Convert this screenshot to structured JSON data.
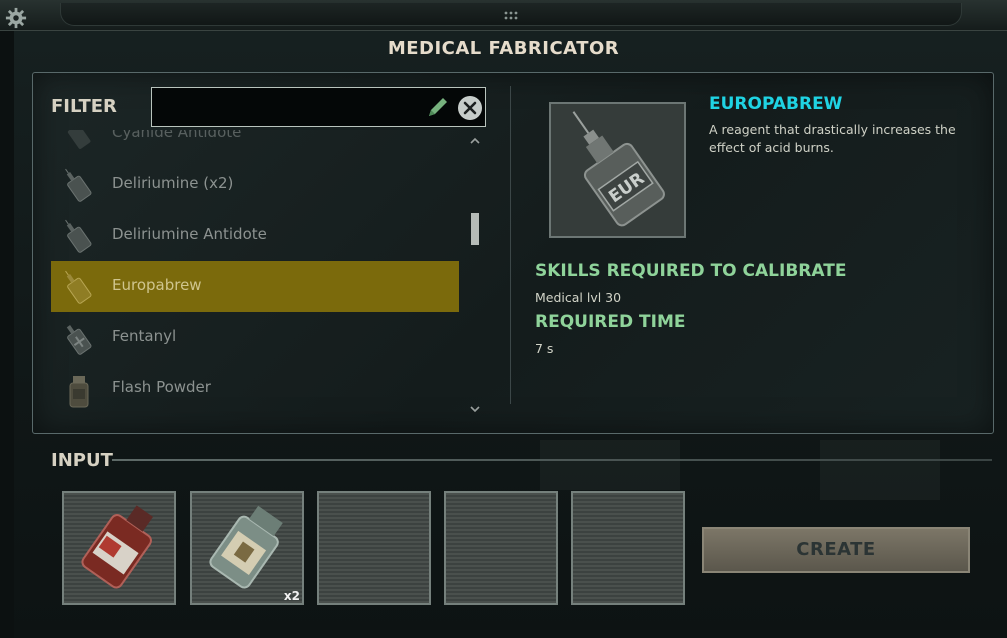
{
  "window": {
    "title": "MEDICAL FABRICATOR"
  },
  "filter": {
    "label": "FILTER",
    "value": ""
  },
  "list": {
    "items": [
      {
        "label": "Cyanide Antidote",
        "icon": "syringe-icon",
        "state": "partial"
      },
      {
        "label": "Deliriumine (x2)",
        "icon": "syringe-del-icon",
        "state": "normal"
      },
      {
        "label": "Deliriumine Antidote",
        "icon": "syringe-antidote-icon",
        "state": "normal"
      },
      {
        "label": "Europabrew",
        "icon": "syringe-eur-icon",
        "state": "selected"
      },
      {
        "label": "Fentanyl",
        "icon": "syringe-plus-icon",
        "state": "normal"
      },
      {
        "label": "Flash Powder",
        "icon": "bottle-icon",
        "state": "normal"
      }
    ]
  },
  "details": {
    "name": "EUROPABREW",
    "description": "A reagent that drastically increases the effect of acid burns.",
    "vial_label": "EUR",
    "skills_heading": "SKILLS REQUIRED TO CALIBRATE",
    "skills_value": "Medical lvl 30",
    "time_heading": "REQUIRED TIME",
    "time_value": "7 s"
  },
  "input": {
    "label": "INPUT",
    "slots": [
      {
        "icon": "blood-bottle-icon",
        "count": ""
      },
      {
        "icon": "pill-bottle-icon",
        "count": "x2"
      },
      {
        "icon": "",
        "count": ""
      },
      {
        "icon": "",
        "count": ""
      },
      {
        "icon": "",
        "count": ""
      }
    ]
  },
  "actions": {
    "create_label": "CREATE"
  },
  "colors": {
    "selected_row": "#7b6a0c",
    "item_name": "#1fd3e3",
    "section_heading": "#8fd39a",
    "create_button": "#6b665a"
  }
}
